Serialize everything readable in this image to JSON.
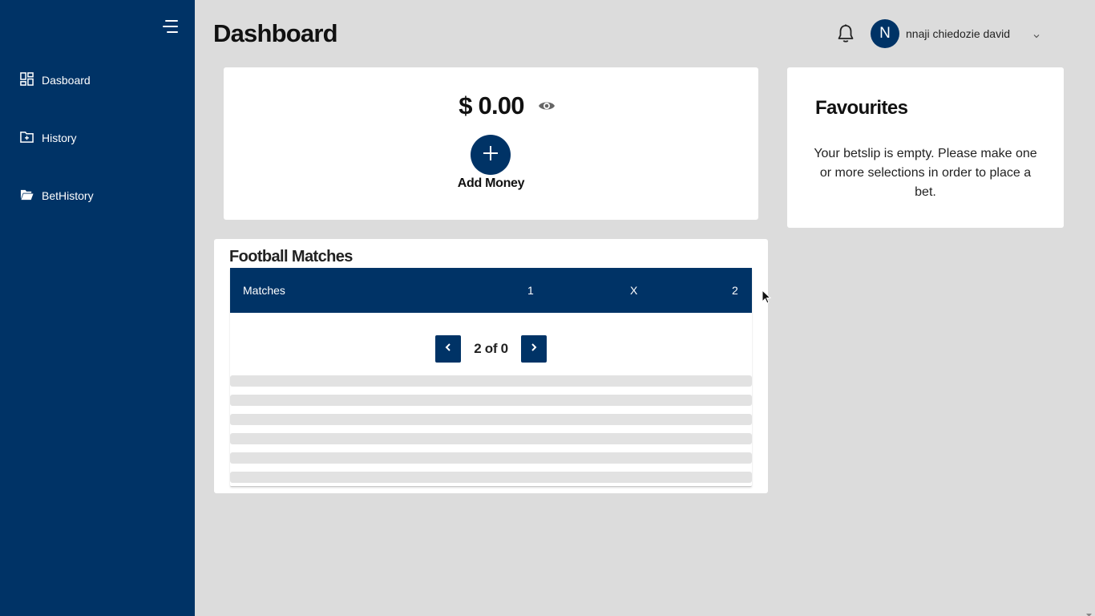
{
  "sidebar": {
    "items": [
      {
        "label": "Dasboard",
        "icon": "dashboard-grid-icon"
      },
      {
        "label": "History",
        "icon": "folder-plus-icon"
      },
      {
        "label": "BetHistory",
        "icon": "folder-open-icon"
      }
    ]
  },
  "header": {
    "title": "Dashboard",
    "user": {
      "initial": "N",
      "name": "nnaji chiedozie david"
    }
  },
  "balance": {
    "amount": "$ 0.00",
    "add_label": "Add Money"
  },
  "favourites": {
    "title": "Favourites",
    "message": "Your betslip is empty. Please make one or more selections in order to place a bet."
  },
  "matches": {
    "title": "Football Matches",
    "columns": [
      "Matches",
      "1",
      "X",
      "2"
    ],
    "page_text": "2 of 0"
  },
  "colors": {
    "primary": "#003366",
    "background": "#dcdcdc",
    "card": "#ffffff"
  }
}
